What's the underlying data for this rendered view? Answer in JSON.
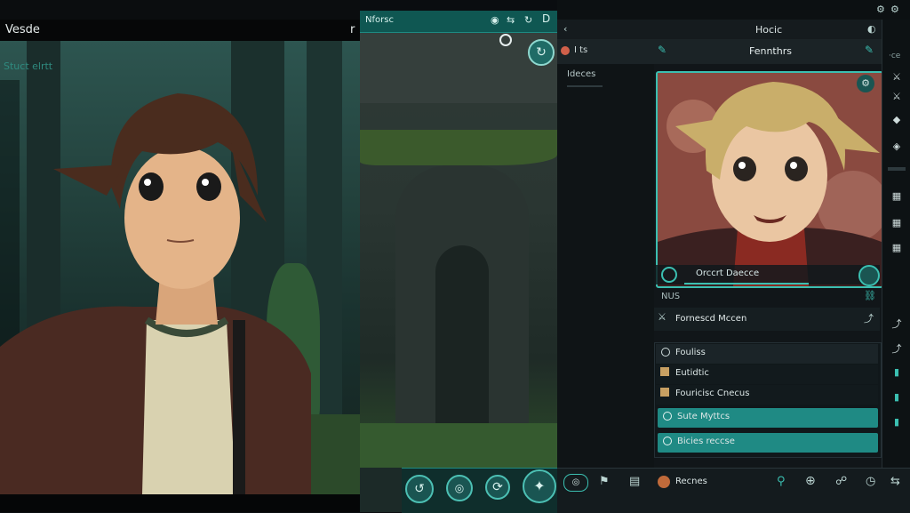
{
  "left_window": {
    "title": "Vesde",
    "subtitle": "Stuct elrtt",
    "topbar_right": "r"
  },
  "middle_window": {
    "header_title": "Nforsc",
    "header_icons": [
      "audio-icon",
      "share-icon",
      "refresh-icon"
    ],
    "header_right": "D"
  },
  "right_app": {
    "nav_title": "Hocic",
    "header_title": "Fennthrs",
    "header_left_label": "I ts",
    "left_col_label": "Ideces",
    "card_caption": "Orccrt Daecce",
    "section_label": "NUS",
    "section_header": "Fornescd Mccen",
    "list_items": [
      {
        "label": "Fouliss",
        "highlighted": false
      },
      {
        "label": "Eutidtic",
        "highlighted": false
      },
      {
        "label": "Fouricisc Cnecus",
        "highlighted": false
      },
      {
        "label": "Sute Myttcs",
        "highlighted": true
      },
      {
        "label": "Bicies reccse",
        "highlighted": true
      }
    ],
    "bottom_toolbar_label": "Recnes",
    "accent": "#3bbfb1"
  }
}
